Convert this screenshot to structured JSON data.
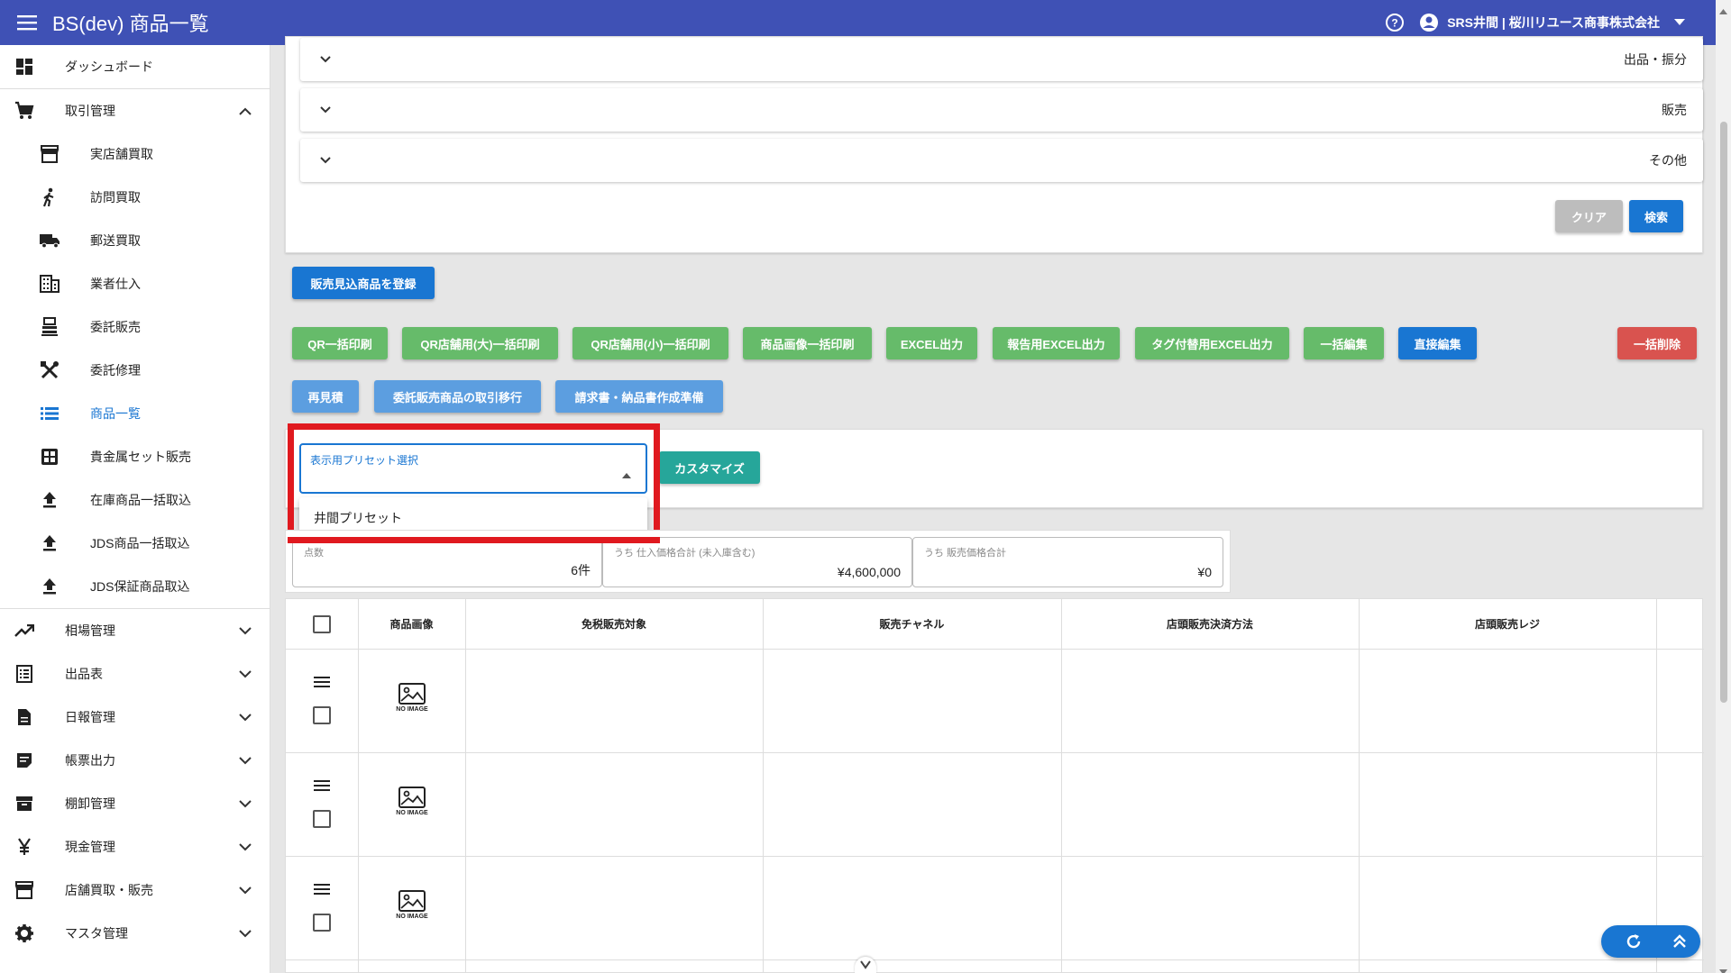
{
  "header": {
    "title": "BS(dev) 商品一覧",
    "user": "SRS井間 | 桜川リユース商事株式会社"
  },
  "sidebar": {
    "dashboard": "ダッシュボード",
    "torihiki": "取引管理",
    "sub_items": [
      "実店舗買取",
      "訪問買取",
      "郵送買取",
      "業者仕入",
      "委託販売",
      "委託修理",
      "商品一覧",
      "貴金属セット販売",
      "在庫商品一括取込",
      "JDS商品一括取込",
      "JDS保証商品取込"
    ],
    "groups": [
      "相場管理",
      "出品表",
      "日報管理",
      "帳票出力",
      "棚卸管理",
      "現金管理",
      "店舗買取・販売",
      "マスタ管理"
    ]
  },
  "accordions": [
    "出品・振分",
    "販売",
    "その他"
  ],
  "filter_buttons": {
    "clear": "クリア",
    "search": "検索"
  },
  "register_button": "販売見込商品を登録",
  "actions_row1": [
    "QR一括印刷",
    "QR店舗用(大)一括印刷",
    "QR店舗用(小)一括印刷",
    "商品画像一括印刷",
    "EXCEL出力",
    "報告用EXCEL出力",
    "タグ付替用EXCEL出力",
    "一括編集",
    "直接編集"
  ],
  "bulk_delete": "一括削除",
  "actions_row2": [
    "再見積",
    "委託販売商品の取引移行",
    "請求書・納品書作成準備"
  ],
  "preset": {
    "label": "表示用プリセット選択",
    "option": "井間プリセット",
    "customize": "カスタマイズ"
  },
  "summary": [
    {
      "label": "点数",
      "value": "6件"
    },
    {
      "label": "うち 仕入価格合計 (未入庫含む)",
      "value": "¥4,600,000"
    },
    {
      "label": "うち 販売価格合計",
      "value": "¥0"
    }
  ],
  "table": {
    "columns": [
      "商品画像",
      "免税販売対象",
      "販売チャネル",
      "店頭販売決済方法",
      "店頭販売レジ"
    ],
    "no_image": "NO IMAGE"
  },
  "colors": {
    "primary": "#3f51b5",
    "accent": "#1976d2",
    "green": "#66bb6a",
    "red": "#d9534f",
    "highlight": "#e0191f"
  }
}
